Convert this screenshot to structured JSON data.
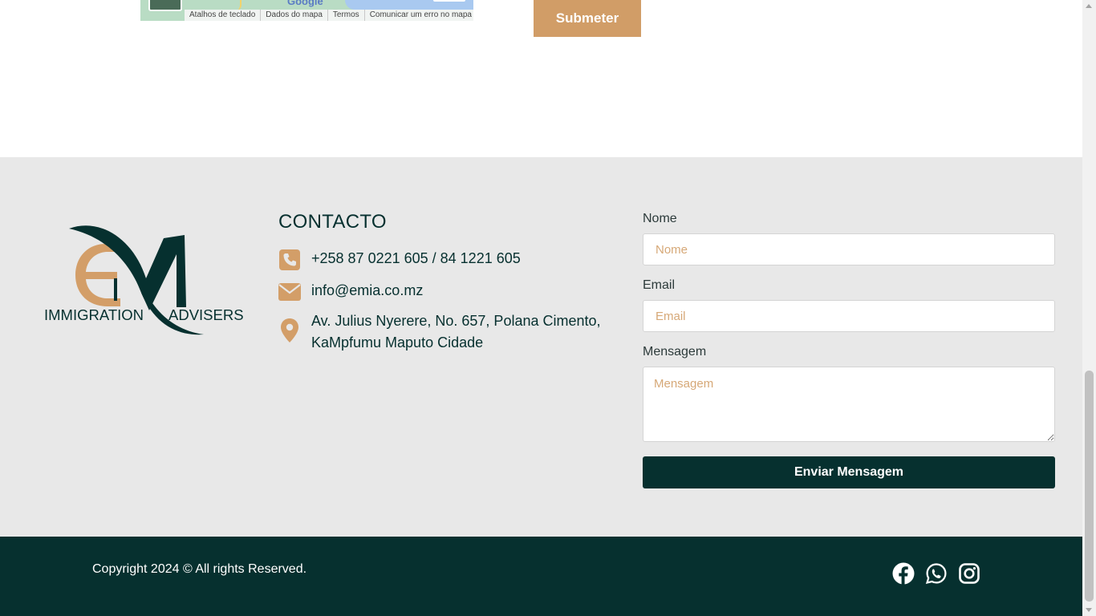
{
  "map": {
    "links": [
      "Atalhos de teclado",
      "Dados do mapa",
      "Termos",
      "Comunicar um erro no mapa"
    ],
    "brand": "Google"
  },
  "top_form": {
    "submit_label": "Submeter"
  },
  "logo": {
    "tagline_left": "IMMIGRATION",
    "tagline_right": "ADVISERS"
  },
  "contact": {
    "title": "CONTACTO",
    "phone": "+258 87 0221 605 / 84 1221 605",
    "email": "info@emia.co.mz",
    "address_line1": "Av. Julius Nyerere, No. 657, Polana Cimento,",
    "address_line2": "KaMpfumu Maputo Cidade"
  },
  "form": {
    "name_label": "Nome",
    "name_placeholder": "Nome",
    "email_label": "Email",
    "email_placeholder": "Email",
    "message_label": "Mensagem",
    "message_placeholder": "Mensagem",
    "send_label": "Enviar Mensagem"
  },
  "footer": {
    "copyright": "Copyright 2024 © All rights Reserved.",
    "social_icons": [
      "facebook-icon",
      "whatsapp-icon",
      "instagram-icon"
    ]
  },
  "colors": {
    "brand_dark": "#06302f",
    "accent": "#d19d67",
    "section_bg": "#e8e8e8"
  }
}
